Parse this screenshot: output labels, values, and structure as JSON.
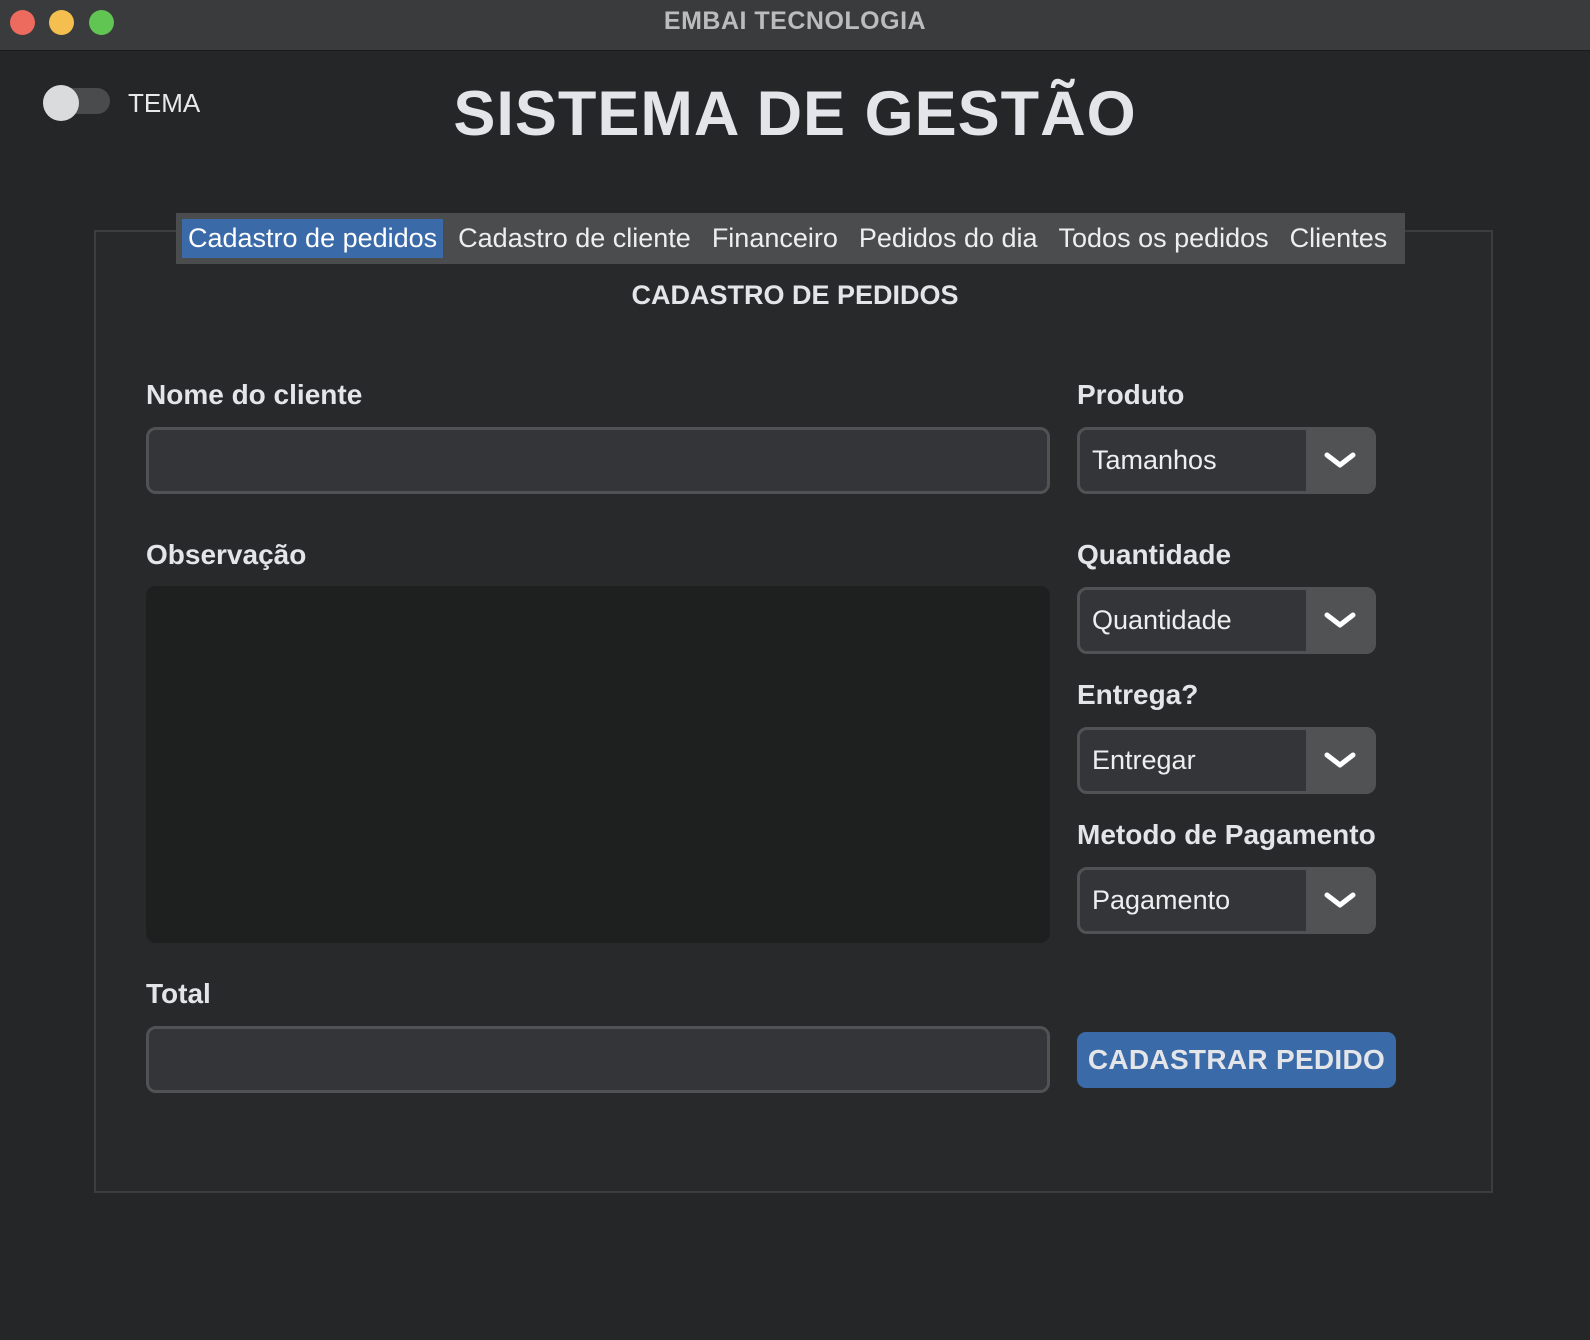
{
  "window": {
    "title": "EMBAI TECNOLOGIA"
  },
  "theme_toggle": {
    "label": "TEMA",
    "on": false
  },
  "header": {
    "title": "SISTEMA DE GESTÃO"
  },
  "tabs": [
    {
      "label": "Cadastro de pedidos",
      "active": true
    },
    {
      "label": "Cadastro de cliente",
      "active": false
    },
    {
      "label": "Financeiro",
      "active": false
    },
    {
      "label": "Pedidos do dia",
      "active": false
    },
    {
      "label": "Todos os pedidos",
      "active": false
    },
    {
      "label": "Clientes",
      "active": false
    }
  ],
  "form": {
    "section_title": "CADASTRO DE PEDIDOS",
    "client_name": {
      "label": "Nome do cliente",
      "value": ""
    },
    "observation": {
      "label": "Observação",
      "value": ""
    },
    "total": {
      "label": "Total",
      "value": ""
    },
    "product": {
      "label": "Produto",
      "value": "Tamanhos"
    },
    "quantity": {
      "label": "Quantidade",
      "value": "Quantidade"
    },
    "delivery": {
      "label": "Entrega?",
      "value": "Entregar"
    },
    "payment": {
      "label": "Metodo de Pagamento",
      "value": "Pagamento"
    },
    "submit_label": "CADASTRAR PEDIDO"
  },
  "colors": {
    "background": "#252627",
    "accent": "#3b6aa8",
    "text": "#e4e5e9"
  }
}
